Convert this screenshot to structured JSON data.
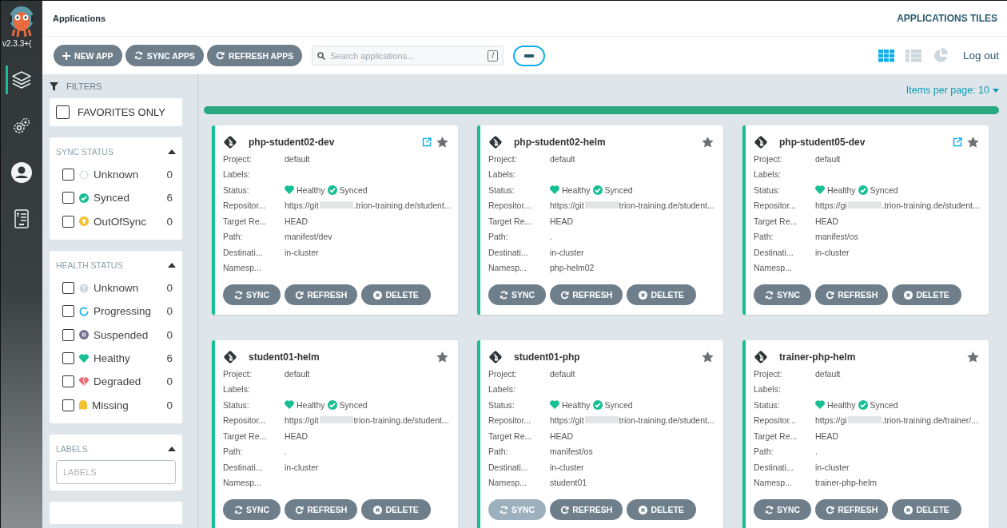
{
  "nav": {
    "version": "v2.3.3+(",
    "items": [
      {
        "kind": "layers",
        "selected": true
      },
      {
        "kind": "gears",
        "selected": false
      },
      {
        "kind": "user",
        "selected": false
      },
      {
        "kind": "docs",
        "selected": false
      }
    ]
  },
  "header": {
    "title": "Applications",
    "view_title": "APPLICATIONS TILES"
  },
  "toolbar": {
    "buttons": [
      {
        "label": "NEW APP",
        "kind": "plus"
      },
      {
        "label": "SYNC APPS",
        "kind": "sync"
      },
      {
        "label": "REFRESH APPS",
        "kind": "refresh"
      }
    ],
    "search": {
      "placeholder": "Search applications...",
      "shortcut": "/"
    },
    "views": [
      {
        "kind": "tiles",
        "selected": true
      },
      {
        "kind": "list",
        "selected": false
      },
      {
        "kind": "summary",
        "selected": false
      }
    ],
    "logout": "Log out"
  },
  "filters": {
    "title": "FILTERS",
    "favorites": {
      "label": "FAVORITES ONLY",
      "checked": false
    },
    "sections": [
      {
        "title": "SYNC STATUS",
        "expanded": true,
        "items": [
          {
            "label": "Unknown",
            "kind": "unknown",
            "count": "0",
            "checked": false
          },
          {
            "label": "Synced",
            "kind": "synced",
            "count": "6",
            "checked": false
          },
          {
            "label": "OutOfSync",
            "kind": "outofsync",
            "count": "0",
            "checked": false
          }
        ]
      },
      {
        "title": "HEALTH STATUS",
        "expanded": true,
        "items": [
          {
            "label": "Unknown",
            "kind": "health-unknown",
            "count": "0",
            "checked": false
          },
          {
            "label": "Progressing",
            "kind": "progressing",
            "count": "0",
            "checked": false
          },
          {
            "label": "Suspended",
            "kind": "suspended",
            "count": "0",
            "checked": false
          },
          {
            "label": "Healthy",
            "kind": "healthy",
            "count": "6",
            "checked": false
          },
          {
            "label": "Degraded",
            "kind": "degraded",
            "count": "0",
            "checked": false
          },
          {
            "label": "Missing",
            "kind": "missing",
            "count": "0",
            "checked": false
          }
        ]
      },
      {
        "title": "LABELS",
        "expanded": true,
        "placeholder": "LABELS"
      }
    ]
  },
  "pagination": {
    "items_per_page": "Items per page: 10"
  },
  "apps": [
    {
      "name": "php-student02-dev",
      "external_link": true,
      "favorite": false,
      "fields": [
        {
          "label": "Project:",
          "value": "default"
        },
        {
          "label": "Labels:"
        },
        {
          "label": "Status:",
          "kind": "status",
          "health": "Healthy",
          "sync": "Synced"
        },
        {
          "label": "Repositor...",
          "kind": "repo",
          "start": "https://git",
          "end": ".trion-training.de/student..."
        },
        {
          "label": "Target Re...",
          "value": "HEAD"
        },
        {
          "label": "Path:",
          "value": "manifest/dev"
        },
        {
          "label": "Destinati...",
          "value": "in-cluster"
        },
        {
          "label": "Namesp..."
        }
      ],
      "buttons": [
        {
          "label": "SYNC",
          "kind": "sync",
          "hovered": false
        },
        {
          "label": "REFRESH",
          "kind": "refresh",
          "hovered": false
        },
        {
          "label": "DELETE",
          "kind": "delete",
          "hovered": false
        }
      ]
    },
    {
      "name": "php-student02-helm",
      "external_link": false,
      "favorite": false,
      "fields": [
        {
          "label": "Project:",
          "value": "default"
        },
        {
          "label": "Labels:"
        },
        {
          "label": "Status:",
          "kind": "status",
          "health": "Healthy",
          "sync": "Synced"
        },
        {
          "label": "Repositor...",
          "kind": "repo",
          "start": "https://git",
          "end": "trion-training.de/student..."
        },
        {
          "label": "Target Re...",
          "value": "HEAD"
        },
        {
          "label": "Path:",
          "value": "."
        },
        {
          "label": "Destinati...",
          "value": "in-cluster"
        },
        {
          "label": "Namesp...",
          "value": "php-helm02"
        }
      ],
      "buttons": [
        {
          "label": "SYNC",
          "kind": "sync",
          "hovered": false
        },
        {
          "label": "REFRESH",
          "kind": "refresh",
          "hovered": false
        },
        {
          "label": "DELETE",
          "kind": "delete",
          "hovered": false
        }
      ]
    },
    {
      "name": "php-student05-dev",
      "external_link": true,
      "favorite": false,
      "fields": [
        {
          "label": "Project:",
          "value": "default"
        },
        {
          "label": "Labels:"
        },
        {
          "label": "Status:",
          "kind": "status",
          "health": "Healthy",
          "sync": "Synced"
        },
        {
          "label": "Repositor...",
          "kind": "repo",
          "start": "https://gi",
          "end": ".trion-training.de/student..."
        },
        {
          "label": "Target Re...",
          "value": "HEAD"
        },
        {
          "label": "Path:",
          "value": "manifest/os"
        },
        {
          "label": "Destinati...",
          "value": "in-cluster"
        },
        {
          "label": "Namesp..."
        }
      ],
      "buttons": [
        {
          "label": "SYNC",
          "kind": "sync",
          "hovered": false
        },
        {
          "label": "REFRESH",
          "kind": "refresh",
          "hovered": false
        },
        {
          "label": "DELETE",
          "kind": "delete",
          "hovered": false
        }
      ]
    },
    {
      "name": "student01-helm",
      "external_link": false,
      "favorite": false,
      "fields": [
        {
          "label": "Project:",
          "value": "default"
        },
        {
          "label": "Labels:"
        },
        {
          "label": "Status:",
          "kind": "status",
          "health": "Healthy",
          "sync": "Synced"
        },
        {
          "label": "Repositor...",
          "kind": "repo",
          "start": "https://git",
          "end": "trion-training.de/student..."
        },
        {
          "label": "Target Re...",
          "value": "HEAD"
        },
        {
          "label": "Path:",
          "value": "."
        },
        {
          "label": "Destinati...",
          "value": "in-cluster"
        },
        {
          "label": "Namesp..."
        }
      ],
      "buttons": [
        {
          "label": "SYNC",
          "kind": "sync",
          "hovered": false
        },
        {
          "label": "REFRESH",
          "kind": "refresh",
          "hovered": false
        },
        {
          "label": "DELETE",
          "kind": "delete",
          "hovered": false
        }
      ]
    },
    {
      "name": "student01-php",
      "external_link": false,
      "favorite": false,
      "fields": [
        {
          "label": "Project:",
          "value": "default"
        },
        {
          "label": "Labels:"
        },
        {
          "label": "Status:",
          "kind": "status",
          "health": "Healthy",
          "sync": "Synced"
        },
        {
          "label": "Repositor...",
          "kind": "repo",
          "start": "https://git",
          "end": "trion-training.de/student..."
        },
        {
          "label": "Target Re...",
          "value": "HEAD"
        },
        {
          "label": "Path:",
          "value": "manifest/os"
        },
        {
          "label": "Destinati...",
          "value": "in-cluster"
        },
        {
          "label": "Namesp...",
          "value": "student01"
        }
      ],
      "buttons": [
        {
          "label": "SYNC",
          "kind": "sync",
          "hovered": true
        },
        {
          "label": "REFRESH",
          "kind": "refresh",
          "hovered": false
        },
        {
          "label": "DELETE",
          "kind": "delete",
          "hovered": false
        }
      ]
    },
    {
      "name": "trainer-php-helm",
      "external_link": false,
      "favorite": false,
      "fields": [
        {
          "label": "Project:",
          "value": "default"
        },
        {
          "label": "Labels:"
        },
        {
          "label": "Status:",
          "kind": "status",
          "health": "Healthy",
          "sync": "Synced"
        },
        {
          "label": "Repositor...",
          "kind": "repo",
          "start": "https://gi",
          "end": ".trion-training.de/trainer/..."
        },
        {
          "label": "Target Re...",
          "value": "HEAD"
        },
        {
          "label": "Path:",
          "value": "."
        },
        {
          "label": "Destinati...",
          "value": "in-cluster"
        },
        {
          "label": "Namesp...",
          "value": "trainer-php-helm"
        }
      ],
      "buttons": [
        {
          "label": "SYNC",
          "kind": "sync",
          "hovered": false
        },
        {
          "label": "REFRESH",
          "kind": "refresh",
          "hovered": false
        },
        {
          "label": "DELETE",
          "kind": "delete",
          "hovered": false
        }
      ]
    }
  ]
}
